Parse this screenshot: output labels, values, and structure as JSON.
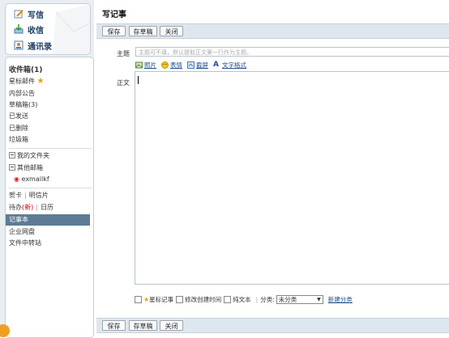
{
  "quick_actions": [
    {
      "label": "写信",
      "icon": "compose-icon"
    },
    {
      "label": "收信",
      "icon": "inbox-download-icon"
    },
    {
      "label": "通讯录",
      "icon": "address-book-icon"
    }
  ],
  "folders": {
    "inbox": "收件箱(1)",
    "starred": "星标邮件",
    "internal_notice": "内部公告",
    "drafts": "草稿箱(3)",
    "sent": "已发送",
    "deleted": "已删除",
    "spam": "垃圾箱",
    "my_folders": "我的文件夹",
    "other_mail": "其他邮箱",
    "account": "exmailkf"
  },
  "tools": {
    "greeting_card": "贺卡",
    "postcard": "明信片",
    "todo_prefix": "待办",
    "todo_new": "(新)",
    "calendar": "日历",
    "notes": "记事本",
    "enterprise_disk": "企业网盘",
    "file_transfer": "文件中转站"
  },
  "main": {
    "title": "写记事",
    "buttons": {
      "save": "保存",
      "save_draft": "存草稿",
      "close": "关闭"
    },
    "subject_label": "主题",
    "subject_placeholder": "主题可不填，默认提取正文第一行作为主题。",
    "body_label": "正文",
    "options": [
      {
        "label": "照片",
        "icon": "photo-icon"
      },
      {
        "label": "表情",
        "icon": "emoji-icon"
      },
      {
        "label": "截屏",
        "icon": "screenshot-icon"
      },
      {
        "label": "文字格式",
        "icon": "text-format-icon"
      }
    ],
    "bottom": {
      "star_note": "星标记事",
      "edit_created_time": "修改创建时间",
      "plain_text": "纯文本",
      "category_label": "分类:",
      "category_value": "未分类",
      "new_category": "新建分类"
    }
  }
}
